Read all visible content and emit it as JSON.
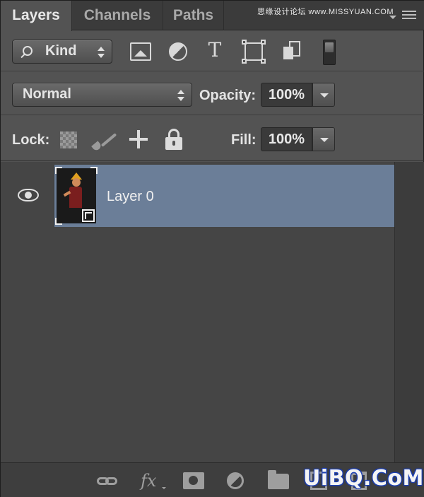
{
  "tabs": [
    {
      "label": "Layers",
      "active": true
    },
    {
      "label": "Channels",
      "active": false
    },
    {
      "label": "Paths",
      "active": false
    }
  ],
  "watermark_top": "思缘设计论坛 www.MISSYUAN.COM",
  "filter": {
    "kind_label": "Kind",
    "icons": [
      "image-filter-icon",
      "adjustment-filter-icon",
      "type-filter-icon",
      "shape-filter-icon",
      "smart-object-filter-icon",
      "filter-toggle-switch"
    ]
  },
  "blend": {
    "mode": "Normal",
    "opacity_label": "Opacity:",
    "opacity_value": "100%"
  },
  "lock": {
    "label": "Lock:",
    "icons": [
      "lock-transparency-icon",
      "lock-image-pixels-icon",
      "lock-position-icon",
      "lock-all-icon"
    ],
    "fill_label": "Fill:",
    "fill_value": "100%"
  },
  "layers": [
    {
      "name": "Layer 0",
      "visible": true,
      "selected": true,
      "smart_object": true
    }
  ],
  "bottom_bar": {
    "icons": [
      "link-layers-icon",
      "layer-style-fx-icon",
      "layer-mask-icon",
      "adjustment-layer-icon",
      "group-folder-icon",
      "new-layer-icon",
      "delete-layer-icon"
    ],
    "watermark": "UiBQ.CoM"
  },
  "colors": {
    "panel_bg": "#535353",
    "list_bg": "#454545",
    "selected_layer": "#6b7e98",
    "tabbar_bg": "#3b3b3b",
    "watermark_blue": "#1b3fb5"
  }
}
